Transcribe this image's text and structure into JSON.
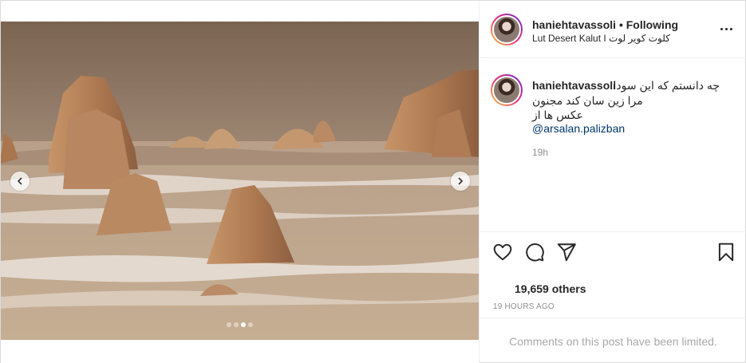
{
  "post": {
    "username": "haniehtavassoli",
    "separator": "•",
    "follow_status": "Following",
    "location": "Lut Desert Kalut I کلوت کویر لوت"
  },
  "caption": {
    "username": "haniehtavassoli",
    "line1": "چه دانستم که این سودا",
    "line2": "مرا زین سان کند مجنون",
    "line3": "عکس ها از",
    "mention": "@arsalan.palizban",
    "time": "19h"
  },
  "stats": {
    "likes": "19,659 others",
    "timestamp": "19 HOURS AGO"
  },
  "comments": {
    "limited_notice": "Comments on this post have been limited."
  },
  "carousel": {
    "slide_count": 4,
    "active_index": 2
  },
  "icons": {
    "more": "more-options-icon",
    "like": "heart-icon",
    "comment": "comment-icon",
    "share": "share-icon",
    "save": "bookmark-icon",
    "prev": "chevron-left-icon",
    "next": "chevron-right-icon"
  },
  "colors": {
    "link": "#00376b",
    "muted": "#8e8e8e",
    "text": "#262626",
    "border": "#efefef"
  }
}
